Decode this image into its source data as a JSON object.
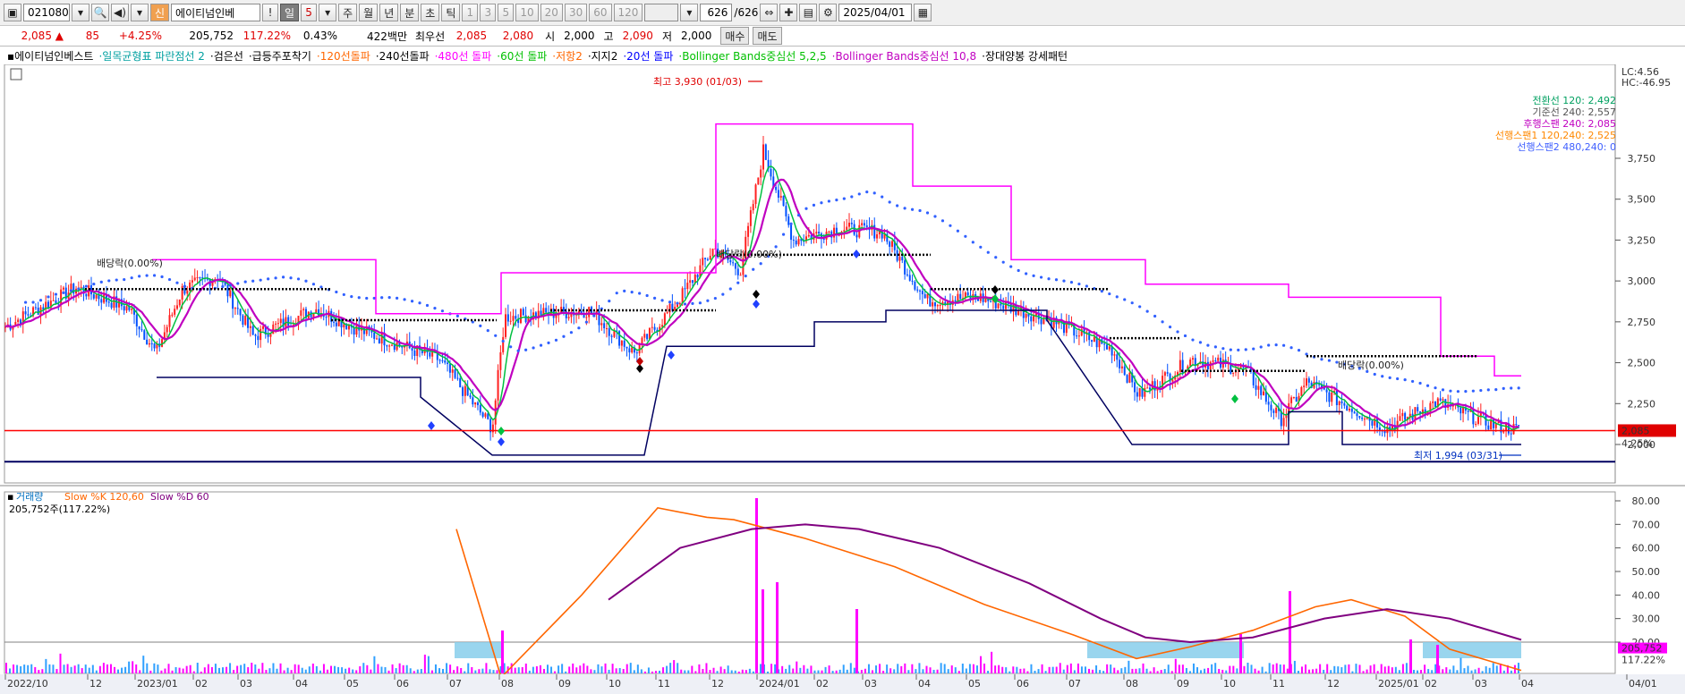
{
  "toolbar": {
    "code": "021080",
    "badge": "신",
    "name": "에이티넘인베",
    "periods": [
      "일",
      "5",
      "주",
      "월",
      "년",
      "분",
      "초",
      "틱"
    ],
    "intervals": [
      "1",
      "3",
      "5",
      "10",
      "20",
      "30",
      "60",
      "120"
    ],
    "count": "626",
    "count_total": "/626",
    "date": "2025/04/01"
  },
  "quote": {
    "price": "2,085",
    "change": "85",
    "change_pct": "+4.25%",
    "volume": "205,752",
    "vol_ratio": "117.22%",
    "turnover": "0.43%",
    "amount": "422백만",
    "best_label": "최우선",
    "ask": "2,085",
    "bid": "2,080",
    "open_label": "시",
    "open": "2,000",
    "high_label": "고",
    "high": "2,090",
    "low_label": "저",
    "low": "2,000",
    "buy_label": "매수",
    "sell_label": "매도"
  },
  "legend": [
    {
      "text": "에이티넘인베스트",
      "color": "#000000"
    },
    {
      "text": "일목균형표 파란점선 2",
      "color": "#00a0a0"
    },
    {
      "text": "검은선",
      "color": "#000000"
    },
    {
      "text": "급등주포착기",
      "color": "#000000"
    },
    {
      "text": "120선돌파",
      "color": "#ff6600"
    },
    {
      "text": "240선돌파",
      "color": "#000000"
    },
    {
      "text": "480선 돌파",
      "color": "#ff00ff"
    },
    {
      "text": "60선 돌파",
      "color": "#00c000"
    },
    {
      "text": "저항2",
      "color": "#ff6600"
    },
    {
      "text": "지지2",
      "color": "#000000"
    },
    {
      "text": "20선 돌파",
      "color": "#0000ff"
    },
    {
      "text": "Bollinger Bands중심선 5,2,5",
      "color": "#00c000"
    },
    {
      "text": "Bollinger Bands중심선 10,8",
      "color": "#c000c0"
    },
    {
      "text": "장대양봉 강세패턴",
      "color": "#000000"
    }
  ],
  "price_chart": {
    "lc": "LC:4.56",
    "hc": "HC:-46.95",
    "y_ticks": [
      "3,750",
      "3,500",
      "3,250",
      "3,000",
      "2,750",
      "2,500",
      "2,250",
      "2,000"
    ],
    "current_price_tag": "2,085",
    "current_pct_tag": "4.25%",
    "high_annotation": "최고 3,930 (01/03)",
    "low_annotation": "최저 1,994 (03/31)",
    "markers": [
      "배당락(0.00%)",
      "배당락(0.00%)",
      "배당락(0.00%)"
    ],
    "ichimoku": [
      {
        "text": "전환선 120: 2,492",
        "color": "#00a060"
      },
      {
        "text": "기준선 240: 2,557",
        "color": "#555555"
      },
      {
        "text": "후행스팬 240: 2,085",
        "color": "#c000c0"
      },
      {
        "text": "선행스팬1 120,240: 2,525",
        "color": "#ff8800"
      },
      {
        "text": "선행스팬2 480,240: 0",
        "color": "#4060ff"
      }
    ]
  },
  "volume_chart": {
    "legend_title": "거래량",
    "legend_k": "Slow %K 120,60",
    "legend_d": "Slow %D 60",
    "info": "205,752주(117.22%)",
    "y_ticks": [
      "80.00",
      "70.00",
      "60.00",
      "50.00",
      "40.00",
      "30.00",
      "20.00"
    ],
    "vol_tag": "205,752",
    "pct_tag": "117.22%"
  },
  "x_axis": [
    "2022/10",
    "12",
    "2023/01",
    "02",
    "03",
    "04",
    "05",
    "06",
    "07",
    "08",
    "09",
    "10",
    "11",
    "12",
    "2024/01",
    "02",
    "03",
    "04",
    "05",
    "06",
    "07",
    "08",
    "09",
    "10",
    "11",
    "12",
    "2025/01",
    "02",
    "03",
    "04",
    "04/01"
  ],
  "colors": {
    "up": "#ff2020",
    "down": "#0050ff",
    "magenta": "#ff00ff",
    "navy": "#000060",
    "stoch_k": "#ff6600",
    "stoch_d": "#800080"
  }
}
